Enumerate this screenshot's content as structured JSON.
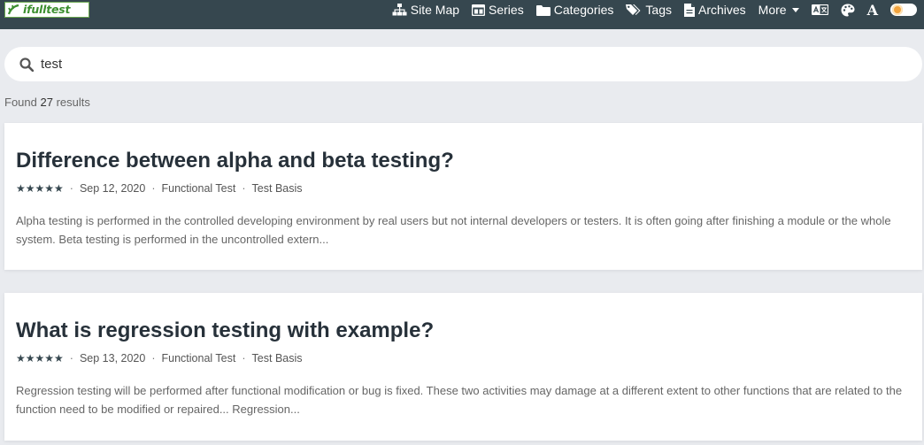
{
  "header": {
    "logo_text": "ifulltest",
    "nav": [
      {
        "label": "Site Map",
        "icon": "sitemap-icon"
      },
      {
        "label": "Series",
        "icon": "series-icon"
      },
      {
        "label": "Categories",
        "icon": "folder-icon"
      },
      {
        "label": "Tags",
        "icon": "tags-icon"
      },
      {
        "label": "Archives",
        "icon": "archive-file-icon"
      },
      {
        "label": "More",
        "icon": "caret-down-icon"
      }
    ],
    "tools": [
      "translate-icon",
      "palette-icon",
      "font-icon",
      "theme-toggle"
    ],
    "font_label": "A",
    "bar_color": "#36474f",
    "accent_color": "#f2a33c"
  },
  "search": {
    "value": "test",
    "placeholder": ""
  },
  "results_summary": {
    "prefix": "Found",
    "count": "27",
    "suffix": "results"
  },
  "results": [
    {
      "title": "Difference between alpha and beta testing?",
      "rating": "★★★★★",
      "date": "Sep 12, 2020",
      "category": "Functional Test",
      "tag": "Test Basis",
      "excerpt": "Alpha testing is performed in the controlled developing environment by real users but not internal developers or testers. It is often going after finishing a module or the whole system. Beta testing is performed in the uncontrolled extern..."
    },
    {
      "title": "What is regression testing with example?",
      "rating": "★★★★★",
      "date": "Sep 13, 2020",
      "category": "Functional Test",
      "tag": "Test Basis",
      "excerpt": "Regression testing will be performed after functional modification or bug is fixed. These two activities may damage at a different extent to other functions that are related to the function need to be modified or repaired... Regression..."
    }
  ]
}
